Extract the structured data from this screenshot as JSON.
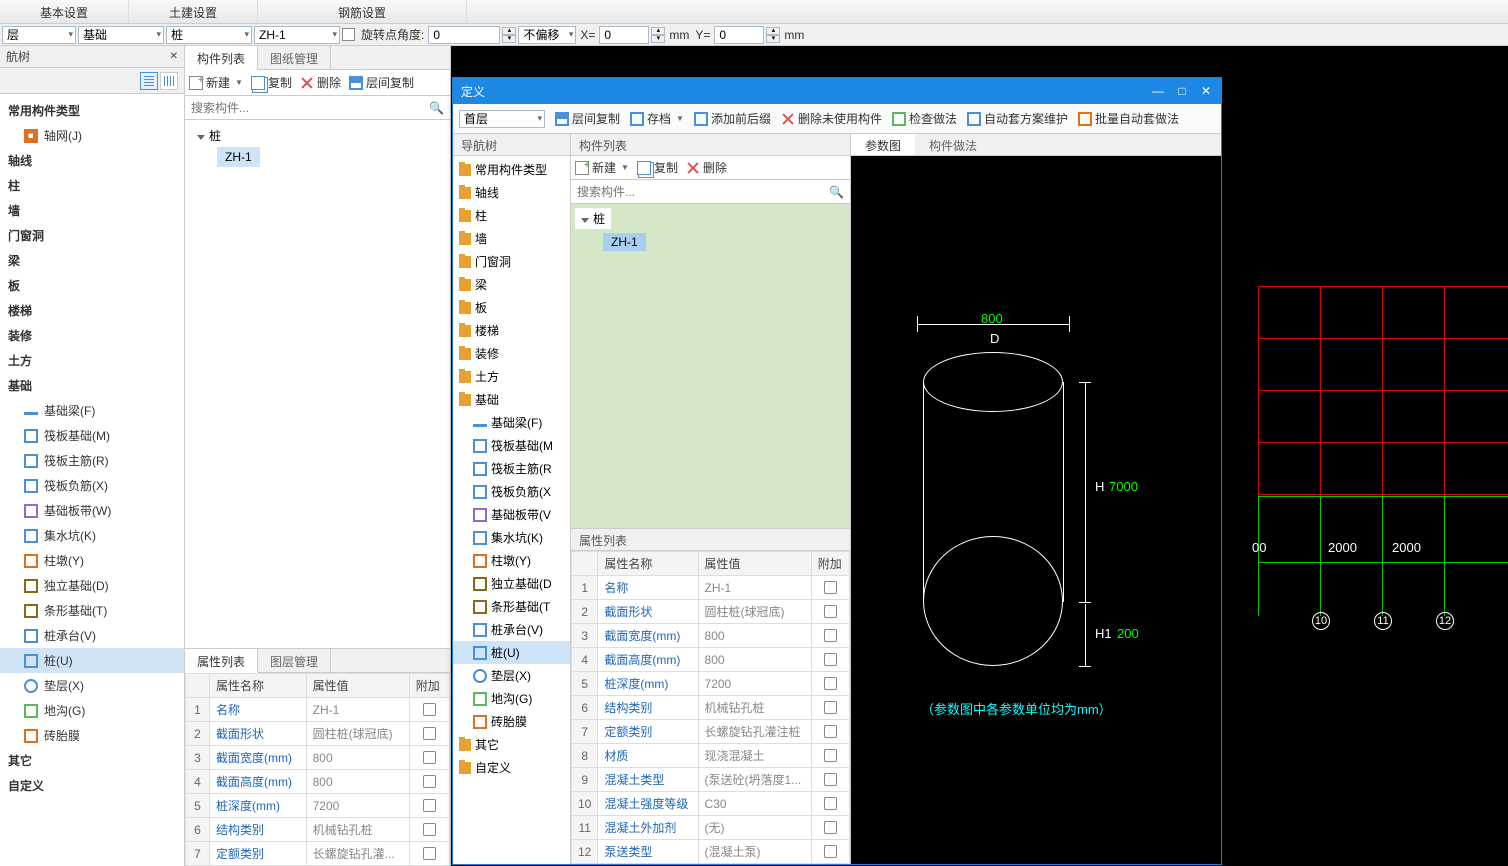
{
  "ribbon": {
    "tabs": [
      "基本设置",
      "土建设置",
      "钢筋设置"
    ]
  },
  "toolbar": {
    "combo1": "层",
    "combo2": "基础",
    "combo3": "桩",
    "combo4": "ZH-1",
    "rot_label": "旋转点角度:",
    "rot_val": "0",
    "off_label": "不偏移",
    "x_label": "X=",
    "x_val": "0",
    "mm1": "mm",
    "y_label": "Y=",
    "y_val": "0",
    "mm2": "mm"
  },
  "nav": {
    "title": "航树",
    "common": "常用构件类型",
    "axis_grid": "轴网(J)",
    "cats": [
      "轴线",
      "柱",
      "墙",
      "门窗洞",
      "梁",
      "板",
      "楼梯",
      "装修",
      "土方"
    ],
    "foundation": "基础",
    "f_items": [
      "基础梁(F)",
      "筏板基础(M)",
      "筏板主筋(R)",
      "筏板负筋(X)",
      "基础板带(W)",
      "集水坑(K)",
      "柱墩(Y)",
      "独立基础(D)",
      "条形基础(T)",
      "桩承台(V)",
      "桩(U)",
      "垫层(X)",
      "地沟(G)",
      "砖胎膜"
    ],
    "other": "其它",
    "custom": "自定义"
  },
  "mid": {
    "tabs": [
      "构件列表",
      "图纸管理"
    ],
    "btns": {
      "new": "新建",
      "copy": "复制",
      "del": "删除",
      "lvl": "层间复制"
    },
    "search_ph": "搜索构件...",
    "tree_root": "桩",
    "tree_item": "ZH-1",
    "prop_tabs": [
      "属性列表",
      "图层管理"
    ],
    "prop_hdr": [
      "",
      "属性名称",
      "属性值",
      "附加"
    ],
    "props": [
      {
        "n": "1",
        "name": "名称",
        "val": "ZH-1"
      },
      {
        "n": "2",
        "name": "截面形状",
        "val": "圆柱桩(球冠底)"
      },
      {
        "n": "3",
        "name": "截面宽度(mm)",
        "val": "800"
      },
      {
        "n": "4",
        "name": "截面高度(mm)",
        "val": "800"
      },
      {
        "n": "5",
        "name": "桩深度(mm)",
        "val": "7200"
      },
      {
        "n": "6",
        "name": "结构类别",
        "val": "机械钻孔桩"
      },
      {
        "n": "7",
        "name": "定额类别",
        "val": "长螺旋钻孔灌..."
      }
    ]
  },
  "dlg": {
    "title": "定义",
    "floor": "首层",
    "tb": [
      "层间复制",
      "存档",
      "添加前后缀",
      "删除未使用构件",
      "检查做法",
      "自动套方案维护",
      "批量自动套做法"
    ],
    "nav_hdr": "导航树",
    "nav_common": "常用构件类型",
    "nav_cats": [
      "轴线",
      "柱",
      "墙",
      "门窗洞",
      "梁",
      "板",
      "楼梯",
      "装修",
      "土方"
    ],
    "nav_foundation": "基础",
    "nav_f": [
      "基础梁(F)",
      "筏板基础(M",
      "筏板主筋(R",
      "筏板负筋(X",
      "基础板带(V",
      "集水坑(K)",
      "柱墩(Y)",
      "独立基础(D",
      "条形基础(T",
      "桩承台(V)",
      "桩(U)",
      "垫层(X)",
      "地沟(G)",
      "砖胎膜"
    ],
    "nav_other": "其它",
    "nav_custom": "自定义",
    "mid_hdr": "构件列表",
    "mid_btns": {
      "new": "新建",
      "copy": "复制",
      "del": "删除"
    },
    "mid_search": "搜索构件...",
    "mid_root": "桩",
    "mid_item": "ZH-1",
    "prop_hdr_label": "属性列表",
    "prop_cols": [
      "",
      "属性名称",
      "属性值",
      "附加"
    ],
    "props": [
      {
        "n": "1",
        "name": "名称",
        "val": "ZH-1"
      },
      {
        "n": "2",
        "name": "截面形状",
        "val": "圆柱桩(球冠底)"
      },
      {
        "n": "3",
        "name": "截面宽度(mm)",
        "val": "800"
      },
      {
        "n": "4",
        "name": "截面高度(mm)",
        "val": "800"
      },
      {
        "n": "5",
        "name": "桩深度(mm)",
        "val": "7200"
      },
      {
        "n": "6",
        "name": "结构类别",
        "val": "机械钻孔桩"
      },
      {
        "n": "7",
        "name": "定额类别",
        "val": "长螺旋钻孔灌注桩"
      },
      {
        "n": "8",
        "name": "材质",
        "val": "现浇混凝土"
      },
      {
        "n": "9",
        "name": "混凝土类型",
        "val": "(泵送砼(坍落度1..."
      },
      {
        "n": "10",
        "name": "混凝土强度等级",
        "val": "C30"
      },
      {
        "n": "11",
        "name": "混凝土外加剂",
        "val": "(无)"
      },
      {
        "n": "12",
        "name": "泵送类型",
        "val": "(混凝土泵)"
      }
    ],
    "right_tabs": [
      "参数图",
      "构件做法"
    ],
    "diag": {
      "d_val": "800",
      "d_label": "D",
      "h_label": "H",
      "h_val": "7000",
      "h1_label": "H1",
      "h1_val": "200",
      "note": "（参数图中各参数单位均为mm）"
    }
  },
  "canvas": {
    "dims": [
      "00",
      "2000",
      "2000"
    ],
    "nums": [
      "10",
      "11",
      "12"
    ]
  }
}
